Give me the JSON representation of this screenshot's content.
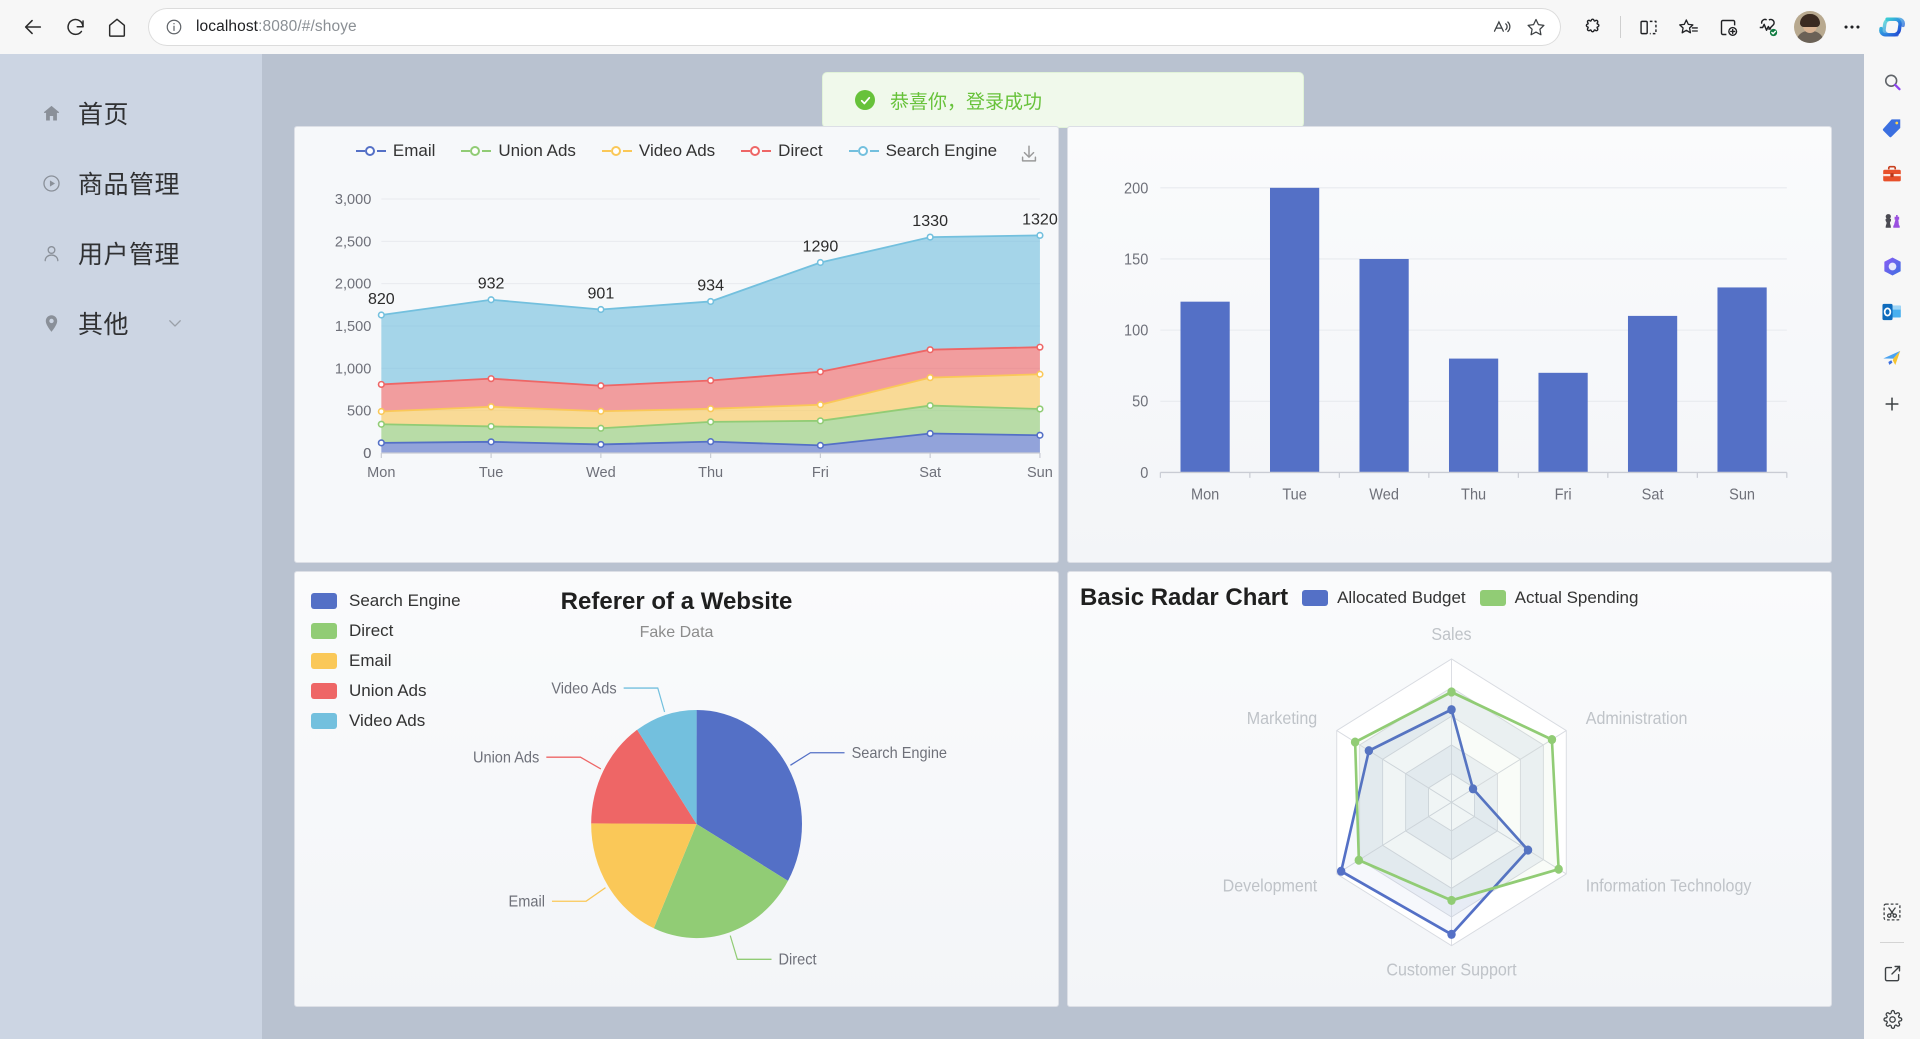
{
  "browser": {
    "back_label": "Back",
    "refresh_label": "Refresh",
    "home_label": "Home",
    "site_info_label": "View site information",
    "url_text": "localhost",
    "url_path": ":8080/#/shoye",
    "read_aloud_label": "Read aloud",
    "favorite_label": "Add this page to favorites",
    "extensions_label": "Extensions",
    "split_screen_label": "Split screen",
    "collections_label": "Collections",
    "add_tab_label": "Browser essentials",
    "performance_label": "Browser essentials",
    "profile_label": "Profile",
    "settings_more_label": "Settings and more",
    "copilot_label": "Copilot"
  },
  "sidebar": {
    "items": [
      {
        "label": "首页",
        "icon": "home-icon",
        "expandable": false
      },
      {
        "label": "商品管理",
        "icon": "play-circle-icon",
        "expandable": false
      },
      {
        "label": "用户管理",
        "icon": "user-icon",
        "expandable": false
      },
      {
        "label": "其他",
        "icon": "location-pin-icon",
        "expandable": true
      }
    ]
  },
  "toast": {
    "message": "恭喜你，登录成功",
    "icon": "success-check-icon",
    "color": "#67c23a",
    "background": "#f0f9eb"
  },
  "edge_rail": {
    "items": [
      {
        "name": "search-icon",
        "glyph": "🔍"
      },
      {
        "name": "shopping-tag-icon",
        "glyph": "🏷"
      },
      {
        "name": "briefcase-icon",
        "glyph": "🧰"
      },
      {
        "name": "games-icon",
        "glyph": "♟"
      },
      {
        "name": "copilot-icon",
        "glyph": "◍"
      },
      {
        "name": "outlook-icon",
        "glyph": "O"
      },
      {
        "name": "tools-icon",
        "glyph": "✈"
      },
      {
        "name": "add-icon",
        "glyph": "＋"
      }
    ],
    "bottom_items": [
      {
        "name": "screenshot-icon",
        "glyph": "✂"
      },
      {
        "name": "open-external-icon",
        "glyph": "⇱"
      },
      {
        "name": "settings-gear-icon",
        "glyph": "⚙"
      }
    ]
  },
  "chart_data": [
    {
      "id": "stacked-area-chart",
      "type": "area",
      "title": "",
      "stacked": true,
      "toolbox": [
        "saveAsImage"
      ],
      "categories": [
        "Mon",
        "Tue",
        "Wed",
        "Thu",
        "Fri",
        "Sat",
        "Sun"
      ],
      "xlabel": "",
      "ylabel": "",
      "ylim": [
        0,
        3000
      ],
      "yticks": [
        "0",
        "500",
        "1,000",
        "1,500",
        "2,000",
        "2,500",
        "3,000"
      ],
      "grid": true,
      "legend_position": "top",
      "series": [
        {
          "name": "Email",
          "color": "#5470c6",
          "values": [
            120,
            132,
            101,
            134,
            90,
            230,
            210
          ]
        },
        {
          "name": "Union Ads",
          "color": "#91cc75",
          "values": [
            220,
            182,
            191,
            234,
            290,
            330,
            310
          ]
        },
        {
          "name": "Video Ads",
          "color": "#fac858",
          "values": [
            150,
            232,
            201,
            154,
            190,
            330,
            410
          ]
        },
        {
          "name": "Direct",
          "color": "#ee6666",
          "values": [
            320,
            332,
            301,
            334,
            390,
            330,
            320
          ]
        },
        {
          "name": "Search Engine",
          "color": "#73c0de",
          "values": [
            820,
            932,
            901,
            934,
            1290,
            1330,
            1320
          ],
          "labels": [
            "820",
            "932",
            "901",
            "934",
            "1290",
            "1330",
            "1320"
          ],
          "show_labels": true
        }
      ]
    },
    {
      "id": "basic-bar-chart",
      "type": "bar",
      "title": "",
      "categories": [
        "Mon",
        "Tue",
        "Wed",
        "Thu",
        "Fri",
        "Sat",
        "Sun"
      ],
      "values": [
        120,
        200,
        150,
        80,
        70,
        110,
        130
      ],
      "color": "#5470c6",
      "xlabel": "",
      "ylabel": "",
      "ylim": [
        0,
        200
      ],
      "yticks": [
        "0",
        "50",
        "100",
        "150",
        "200"
      ],
      "grid": true,
      "legend_position": "none"
    },
    {
      "id": "referer-pie-chart",
      "type": "pie",
      "title": "Referer of a Website",
      "subtitle": "Fake Data",
      "legend_position": "left",
      "legend": [
        "Search Engine",
        "Direct",
        "Email",
        "Union Ads",
        "Video Ads"
      ],
      "categories": [
        "Search Engine",
        "Direct",
        "Email",
        "Union Ads",
        "Video Ads"
      ],
      "values": [
        1048,
        735,
        580,
        484,
        300
      ],
      "colors": [
        "#5470c6",
        "#91cc75",
        "#fac858",
        "#ee6666",
        "#73c0de"
      ],
      "labels": [
        "Search Engine",
        "Direct",
        "Email",
        "Union Ads",
        "Video Ads"
      ]
    },
    {
      "id": "basic-radar-chart",
      "type": "radar",
      "title": "Basic Radar Chart",
      "legend_position": "top",
      "indicators": [
        {
          "name": "Sales",
          "max": 6500
        },
        {
          "name": "Administration",
          "max": 16000
        },
        {
          "name": "Information Technology",
          "max": 30000
        },
        {
          "name": "Customer Support",
          "max": 38000
        },
        {
          "name": "Development",
          "max": 52000
        },
        {
          "name": "Marketing",
          "max": 25000
        }
      ],
      "series": [
        {
          "name": "Allocated Budget",
          "color": "#5470c6",
          "values": [
            4200,
            3000,
            20000,
            35000,
            50000,
            18000
          ]
        },
        {
          "name": "Actual Spending",
          "color": "#91cc75",
          "values": [
            5000,
            14000,
            28000,
            26000,
            42000,
            21000
          ]
        }
      ]
    }
  ]
}
